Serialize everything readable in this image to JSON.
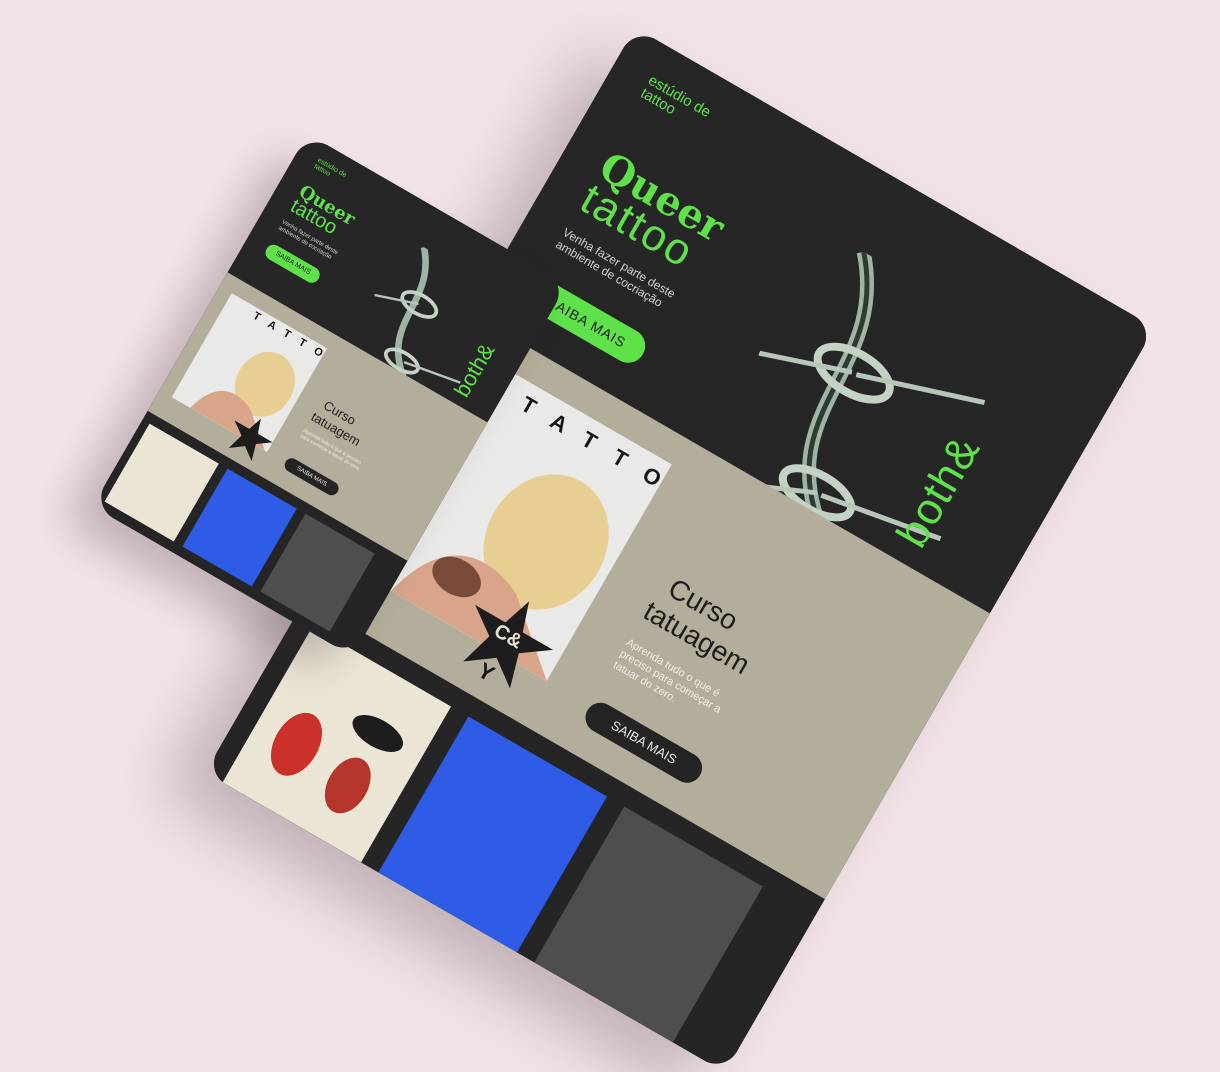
{
  "hero": {
    "studio": "estúdio de tattoo",
    "title_line1": "Queer",
    "title_line2": "tattoo",
    "subtitle": "Venha fazer parte deste ambiente de cocriação",
    "cta": "SAIBA MAIS",
    "brand": "both&"
  },
  "course": {
    "badge_top": "TATTOO",
    "badge_letters": "BY",
    "title_line1": "Curso",
    "title_line2": "tatuagem",
    "description": "Aprenda tudo o que é preciso para começar a tatuar do zero.",
    "cta": "SAIBA MAIS",
    "star_monogram": "C&"
  },
  "colors": {
    "background": "#f1e3e6",
    "dark": "#252525",
    "accent": "#5fe14a",
    "khaki": "#b3ae9b",
    "blue": "#2f5ce6"
  }
}
